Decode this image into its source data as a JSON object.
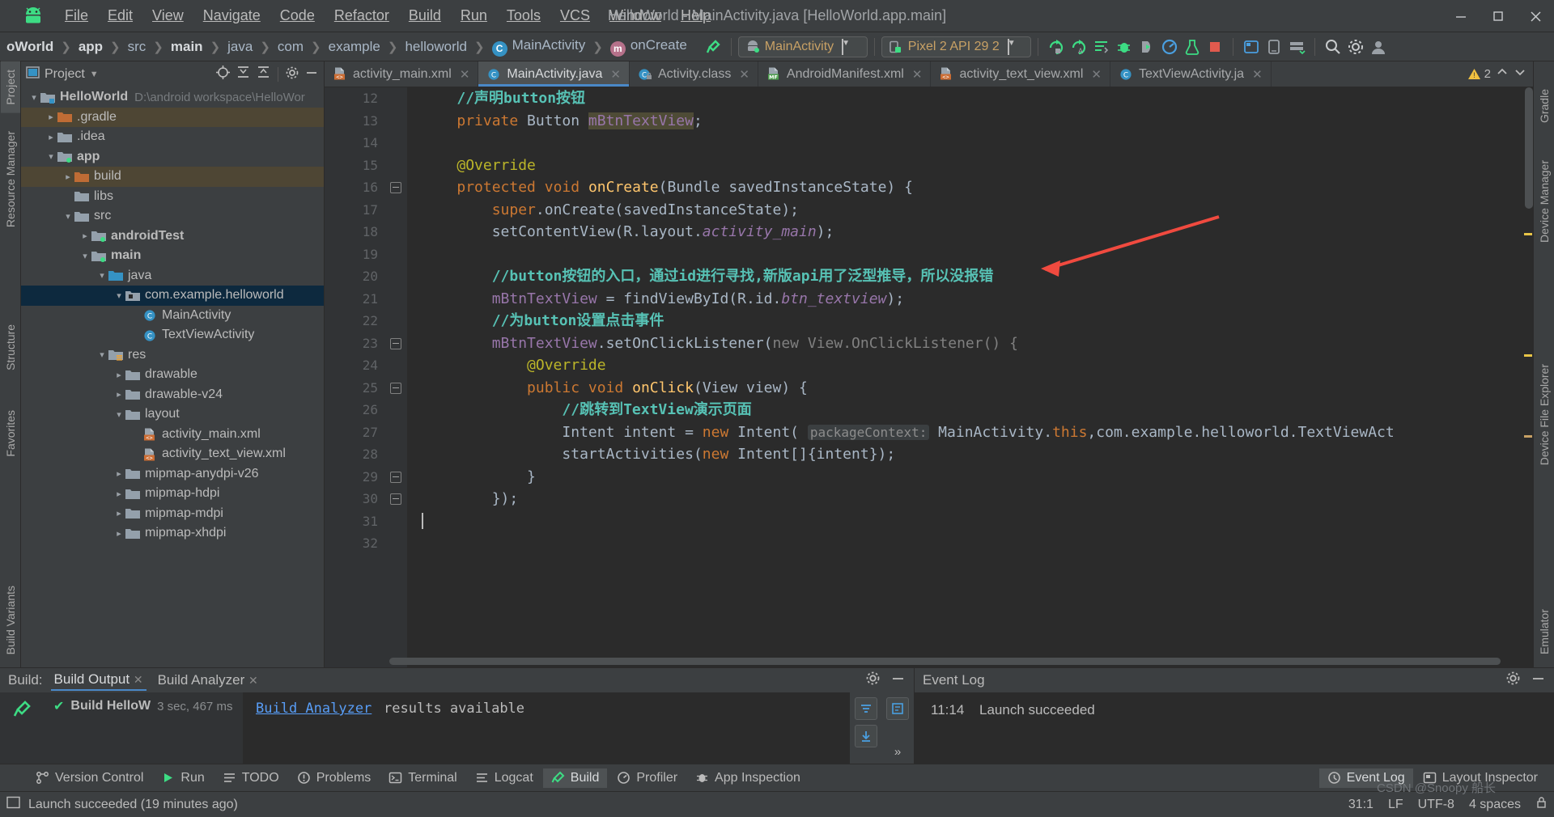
{
  "window": {
    "title": "HelloWorld - MainActivity.java [HelloWorld.app.main]",
    "minimize": "—",
    "maximize": "▢",
    "close": "✕"
  },
  "menu": [
    {
      "label": "File"
    },
    {
      "label": "Edit"
    },
    {
      "label": "View"
    },
    {
      "label": "Navigate"
    },
    {
      "label": "Code"
    },
    {
      "label": "Refactor"
    },
    {
      "label": "Build"
    },
    {
      "label": "Run"
    },
    {
      "label": "Tools"
    },
    {
      "label": "VCS"
    },
    {
      "label": "Window"
    },
    {
      "label": "Help"
    }
  ],
  "navbar": {
    "crumbs": [
      "oWorld",
      "app",
      "src",
      "main",
      "java",
      "com",
      "example",
      "helloworld"
    ],
    "class_crumb": "MainActivity",
    "method_crumb": "onCreate",
    "class_badge": "C",
    "method_badge": "m",
    "run_config": "MainActivity",
    "device": "Pixel 2 API 29 2",
    "caret": "▼"
  },
  "left_strip": [
    {
      "label": "Project",
      "active": true
    },
    {
      "label": "Resource Manager",
      "active": false
    },
    {
      "label": "Structure",
      "active": false
    },
    {
      "label": "Favorites",
      "active": false
    },
    {
      "label": "Build Variants",
      "active": false
    }
  ],
  "right_strip": [
    {
      "label": "Gradle"
    },
    {
      "label": "Device Manager"
    },
    {
      "label": "Device File Explorer"
    },
    {
      "label": "Emulator"
    }
  ],
  "project_panel": {
    "title": "Project",
    "caret": "▼",
    "tree": [
      {
        "indent": 0,
        "twist": "⌄",
        "label": "HelloWorld",
        "bold": true,
        "path": "D:\\android workspace\\HelloWor",
        "icon": "module-folder",
        "state": "normal"
      },
      {
        "indent": 1,
        "twist": "›",
        "label": ".gradle",
        "bold": false,
        "icon": "excluded-folder",
        "state": "excluded"
      },
      {
        "indent": 1,
        "twist": "›",
        "label": ".idea",
        "bold": false,
        "icon": "folder",
        "state": "normal"
      },
      {
        "indent": 1,
        "twist": "⌄",
        "label": "app",
        "bold": true,
        "icon": "module-folder-green",
        "state": "normal"
      },
      {
        "indent": 2,
        "twist": "›",
        "label": "build",
        "bold": false,
        "icon": "excluded-folder",
        "state": "excluded"
      },
      {
        "indent": 2,
        "twist": "",
        "label": "libs",
        "bold": false,
        "icon": "folder",
        "state": "normal"
      },
      {
        "indent": 2,
        "twist": "⌄",
        "label": "src",
        "bold": false,
        "icon": "folder",
        "state": "normal"
      },
      {
        "indent": 3,
        "twist": "›",
        "label": "androidTest",
        "bold": true,
        "icon": "module-folder-green",
        "state": "normal"
      },
      {
        "indent": 3,
        "twist": "⌄",
        "label": "main",
        "bold": true,
        "icon": "module-folder-green",
        "state": "normal"
      },
      {
        "indent": 4,
        "twist": "⌄",
        "label": "java",
        "bold": false,
        "icon": "source-folder",
        "state": "normal"
      },
      {
        "indent": 5,
        "twist": "⌄",
        "label": "com.example.helloworld",
        "bold": false,
        "icon": "package-folder",
        "state": "selected"
      },
      {
        "indent": 6,
        "twist": "",
        "label": "MainActivity",
        "bold": false,
        "icon": "java-class",
        "state": "normal"
      },
      {
        "indent": 6,
        "twist": "",
        "label": "TextViewActivity",
        "bold": false,
        "icon": "java-class",
        "state": "normal"
      },
      {
        "indent": 4,
        "twist": "⌄",
        "label": "res",
        "bold": false,
        "icon": "res-folder",
        "state": "normal"
      },
      {
        "indent": 5,
        "twist": "›",
        "label": "drawable",
        "bold": false,
        "icon": "folder",
        "state": "normal"
      },
      {
        "indent": 5,
        "twist": "›",
        "label": "drawable-v24",
        "bold": false,
        "icon": "folder",
        "state": "normal"
      },
      {
        "indent": 5,
        "twist": "⌄",
        "label": "layout",
        "bold": false,
        "icon": "folder",
        "state": "normal"
      },
      {
        "indent": 6,
        "twist": "",
        "label": "activity_main.xml",
        "bold": false,
        "icon": "xml-file",
        "state": "normal"
      },
      {
        "indent": 6,
        "twist": "",
        "label": "activity_text_view.xml",
        "bold": false,
        "icon": "xml-file",
        "state": "normal"
      },
      {
        "indent": 5,
        "twist": "›",
        "label": "mipmap-anydpi-v26",
        "bold": false,
        "icon": "folder",
        "state": "normal"
      },
      {
        "indent": 5,
        "twist": "›",
        "label": "mipmap-hdpi",
        "bold": false,
        "icon": "folder",
        "state": "normal"
      },
      {
        "indent": 5,
        "twist": "›",
        "label": "mipmap-mdpi",
        "bold": false,
        "icon": "folder",
        "state": "normal"
      },
      {
        "indent": 5,
        "twist": "›",
        "label": "mipmap-xhdpi",
        "bold": false,
        "icon": "folder",
        "state": "normal"
      }
    ]
  },
  "editor_tabs": [
    {
      "label": "activity_main.xml",
      "icon": "xml-file",
      "active": false
    },
    {
      "label": "MainActivity.java",
      "icon": "java-class",
      "active": true
    },
    {
      "label": "Activity.class",
      "icon": "java-class-locked",
      "active": false
    },
    {
      "label": "AndroidManifest.xml",
      "icon": "manifest-file",
      "active": false
    },
    {
      "label": "activity_text_view.xml",
      "icon": "xml-file",
      "active": false
    },
    {
      "label": "TextViewActivity.ja",
      "icon": "java-class",
      "active": false
    }
  ],
  "inspection": {
    "count": "2",
    "icon": "warning-triangle"
  },
  "code": {
    "first_line": 12,
    "lines": [
      {
        "n": 12,
        "marker": "",
        "fold": false,
        "tokens": [
          {
            "t": "    ",
            "c": "plain"
          },
          {
            "t": "//声明button按钮",
            "c": "cz"
          }
        ]
      },
      {
        "n": 13,
        "marker": "",
        "fold": false,
        "tokens": [
          {
            "t": "    ",
            "c": "plain"
          },
          {
            "t": "private",
            "c": "k"
          },
          {
            "t": " Button ",
            "c": "plain"
          },
          {
            "t": "mBtnTextView",
            "c": "f hl"
          },
          {
            "t": ";",
            "c": "plain"
          }
        ]
      },
      {
        "n": 14,
        "marker": "",
        "fold": false,
        "tokens": []
      },
      {
        "n": 15,
        "marker": "",
        "fold": false,
        "tokens": [
          {
            "t": "    ",
            "c": "plain"
          },
          {
            "t": "@Override",
            "c": "ann"
          }
        ]
      },
      {
        "n": 16,
        "marker": "override-up",
        "fold": true,
        "tokens": [
          {
            "t": "    ",
            "c": "plain"
          },
          {
            "t": "protected",
            "c": "k"
          },
          {
            "t": " ",
            "c": "plain"
          },
          {
            "t": "void",
            "c": "k"
          },
          {
            "t": " ",
            "c": "plain"
          },
          {
            "t": "onCreate",
            "c": "fn"
          },
          {
            "t": "(Bundle savedInstanceState) {",
            "c": "plain"
          }
        ]
      },
      {
        "n": 17,
        "marker": "",
        "fold": false,
        "tokens": [
          {
            "t": "        ",
            "c": "plain"
          },
          {
            "t": "super",
            "c": "k"
          },
          {
            "t": ".onCreate(savedInstanceState);",
            "c": "plain"
          }
        ]
      },
      {
        "n": 18,
        "marker": "",
        "fold": false,
        "tokens": [
          {
            "t": "        setContentView(R.layout.",
            "c": "plain"
          },
          {
            "t": "activity_main",
            "c": "fi"
          },
          {
            "t": ");",
            "c": "plain"
          }
        ]
      },
      {
        "n": 19,
        "marker": "",
        "fold": false,
        "tokens": []
      },
      {
        "n": 20,
        "marker": "",
        "fold": false,
        "tokens": [
          {
            "t": "        ",
            "c": "plain"
          },
          {
            "t": "//button按钮的入口，通过id进行寻找,新版api用了泛型推导，所以没报错",
            "c": "cz"
          }
        ]
      },
      {
        "n": 21,
        "marker": "",
        "fold": false,
        "tokens": [
          {
            "t": "        ",
            "c": "plain"
          },
          {
            "t": "mBtnTextView",
            "c": "f"
          },
          {
            "t": " = findViewById(R.id.",
            "c": "plain"
          },
          {
            "t": "btn_textview",
            "c": "fi"
          },
          {
            "t": ");",
            "c": "plain"
          }
        ]
      },
      {
        "n": 22,
        "marker": "",
        "fold": false,
        "tokens": [
          {
            "t": "        ",
            "c": "plain"
          },
          {
            "t": "//为button设置点击事件",
            "c": "cz"
          }
        ]
      },
      {
        "n": 23,
        "marker": "",
        "fold": true,
        "tokens": [
          {
            "t": "        ",
            "c": "plain"
          },
          {
            "t": "mBtnTextView",
            "c": "f"
          },
          {
            "t": ".setOnClickListener(",
            "c": "plain"
          },
          {
            "t": "new",
            "c": "gr"
          },
          {
            "t": " ",
            "c": "plain"
          },
          {
            "t": "View.OnClickListener() {",
            "c": "gr"
          }
        ]
      },
      {
        "n": 24,
        "marker": "",
        "fold": false,
        "tokens": [
          {
            "t": "            ",
            "c": "plain"
          },
          {
            "t": "@Override",
            "c": "ann"
          }
        ]
      },
      {
        "n": 25,
        "marker": "override-impl",
        "fold": true,
        "tokens": [
          {
            "t": "            ",
            "c": "plain"
          },
          {
            "t": "public",
            "c": "k"
          },
          {
            "t": " ",
            "c": "plain"
          },
          {
            "t": "void",
            "c": "k"
          },
          {
            "t": " ",
            "c": "plain"
          },
          {
            "t": "onClick",
            "c": "fn"
          },
          {
            "t": "(View view) {",
            "c": "plain"
          }
        ]
      },
      {
        "n": 26,
        "marker": "",
        "fold": false,
        "tokens": [
          {
            "t": "                ",
            "c": "plain"
          },
          {
            "t": "//跳转到TextView演示页面",
            "c": "cz"
          }
        ]
      },
      {
        "n": 27,
        "marker": "",
        "fold": false,
        "tokens": [
          {
            "t": "                Intent intent = ",
            "c": "plain"
          },
          {
            "t": "new",
            "c": "k"
          },
          {
            "t": " Intent( ",
            "c": "plain"
          },
          {
            "t": "packageContext:",
            "c": "hint"
          },
          {
            "t": " MainActivity.",
            "c": "plain"
          },
          {
            "t": "this",
            "c": "k"
          },
          {
            "t": ",com.example.helloworld.TextViewAct",
            "c": "plain"
          }
        ]
      },
      {
        "n": 28,
        "marker": "",
        "fold": false,
        "tokens": [
          {
            "t": "                startActivities(",
            "c": "plain"
          },
          {
            "t": "new",
            "c": "k"
          },
          {
            "t": " Intent[]{intent});",
            "c": "plain"
          }
        ]
      },
      {
        "n": 29,
        "marker": "",
        "fold": true,
        "tokens": [
          {
            "t": "            }",
            "c": "plain"
          }
        ]
      },
      {
        "n": 30,
        "marker": "",
        "fold": true,
        "tokens": [
          {
            "t": "        });",
            "c": "plain"
          }
        ]
      },
      {
        "n": 31,
        "marker": "",
        "fold": false,
        "tokens": [
          {
            "t": "",
            "c": "caret"
          }
        ]
      },
      {
        "n": 32,
        "marker": "",
        "fold": false,
        "tokens": []
      }
    ]
  },
  "build_panel": {
    "label": "Build:",
    "tabs": [
      {
        "label": "Build Output",
        "active": true,
        "close": "✕"
      },
      {
        "label": "Build Analyzer",
        "active": false,
        "close": "✕"
      }
    ],
    "gear_icon": "gear-icon",
    "minimize_icon": "minimize-icon",
    "tree_row": {
      "status": "✔",
      "label": "Build HelloW",
      "time": "3 sec, 467 ms"
    },
    "output_link": "Build Analyzer",
    "output_text": "results available",
    "side_buttons": [
      "filter-icon",
      "edit-icon",
      "download-icon",
      "expand-icon"
    ]
  },
  "event_log": {
    "title": "Event Log",
    "gear_icon": "gear-icon",
    "minimize_icon": "minimize-icon",
    "entries": [
      {
        "time": "11:14",
        "message": "Launch succeeded"
      }
    ]
  },
  "tool_window_bar": {
    "left": [
      {
        "label": "Version Control",
        "icon": "branch-icon",
        "active": false
      },
      {
        "label": "Run",
        "icon": "play-icon",
        "active": false
      },
      {
        "label": "TODO",
        "icon": "list-icon",
        "active": false
      },
      {
        "label": "Problems",
        "icon": "error-icon",
        "active": false
      },
      {
        "label": "Terminal",
        "icon": "terminal-icon",
        "active": false
      },
      {
        "label": "Logcat",
        "icon": "logcat-icon",
        "active": false
      },
      {
        "label": "Build",
        "icon": "hammer-icon",
        "active": true
      },
      {
        "label": "Profiler",
        "icon": "gauge-icon",
        "active": false
      },
      {
        "label": "App Inspection",
        "icon": "inspect-icon",
        "active": false
      }
    ],
    "right": [
      {
        "label": "Event Log",
        "icon": "event-icon",
        "active": true
      },
      {
        "label": "Layout Inspector",
        "icon": "layout-icon",
        "active": false
      }
    ]
  },
  "status_bar": {
    "icon": "console-icon",
    "message": "Launch succeeded (19 minutes ago)",
    "position": "31:1",
    "line_sep": "LF",
    "encoding": "UTF-8",
    "indent": "4 spaces",
    "watermark": "CSDN @Snoopy 船长"
  },
  "colors": {
    "accent": "#4a88c7",
    "selection": "#0d293e",
    "excluded": "#4e4634",
    "comment": "#57c2b5",
    "keyword": "#cc7832",
    "field": "#9876aa",
    "method": "#ffc66d",
    "annotation_arrow": "#f04a3f"
  }
}
